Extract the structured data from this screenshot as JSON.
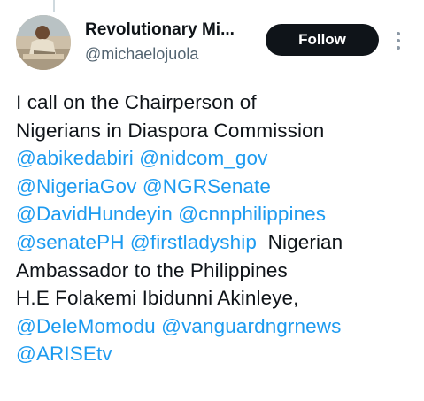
{
  "header": {
    "display_name": "Revolutionary Mi...",
    "username": "@michaelojuola",
    "follow_label": "Follow",
    "more_icon": "more-vertical-icon"
  },
  "tweet": {
    "line1": {
      "text": "I call on the Chairperson of"
    },
    "line2": {
      "text": "Nigerians in Diaspora Commission"
    },
    "line3": {
      "mention1": "@abikedabiri",
      "mention2": "@nidcom_gov"
    },
    "line4": {
      "mention1": "@NigeriaGov",
      "mention2": "@NGRSenate"
    },
    "line5": {
      "mention1": "@DavidHundeyin",
      "mention2": "@cnnphilippines"
    },
    "line6": {
      "mention1": "@senatePH",
      "mention2": "@firstladyship",
      "text": "Nigerian"
    },
    "line7": {
      "text": "Ambassador to the Philippines"
    },
    "line8": {
      "text": "H.E Folakemi Ibidunni Akinleye,"
    },
    "line9": {
      "mention1": "@DeleMomodu",
      "mention2": "@vanguardngrnews"
    },
    "line10": {
      "mention1": "@ARISEtv"
    }
  },
  "colors": {
    "text": "#0f1419",
    "mention": "#1d9bf0",
    "secondary": "#536471",
    "follow_bg": "#0f1419",
    "follow_text": "#ffffff"
  }
}
